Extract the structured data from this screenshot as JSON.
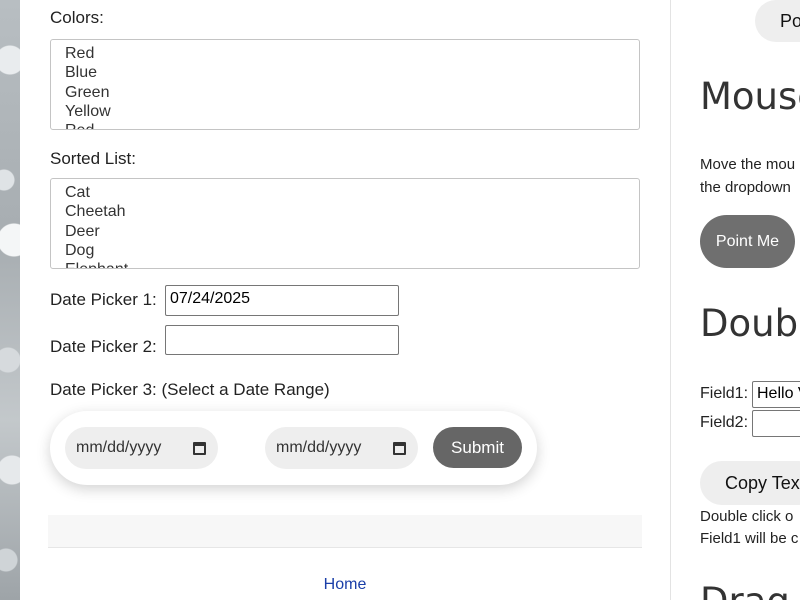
{
  "main": {
    "colors_label": "Colors:",
    "colors_options": [
      "Red",
      "Blue",
      "Green",
      "Yellow",
      "Red"
    ],
    "sorted_label": "Sorted List:",
    "sorted_options": [
      "Cat",
      "Cheetah",
      "Deer",
      "Dog",
      "Elephant"
    ],
    "date_picker_1_label": "Date Picker 1:",
    "date_picker_1_value": "07/24/2025",
    "date_picker_2_label": "Date Picker 2:",
    "date_picker_2_value": "",
    "date_picker_3_label": "Date Picker 3: (Select a Date Range)",
    "range_start_placeholder": "mm/dd/yyyy",
    "range_end_placeholder": "mm/dd/yyyy",
    "submit_label": "Submit",
    "home_link": "Home"
  },
  "right": {
    "top_button_label": "Po",
    "mouse_heading": "Mouse",
    "mouse_text_line1": "Move the mou",
    "mouse_text_line2": "the dropdown",
    "point_me_label": "Point Me",
    "double_heading": "Double",
    "field1_label": "Field1:",
    "field1_value": "Hello V",
    "field2_label": "Field2:",
    "field2_value": "",
    "copy_button_label": "Copy Tex",
    "double_text_line1": "Double click o",
    "double_text_line2": "Field1 will be c",
    "drag_heading": "Drag"
  },
  "icons": {
    "calendar": "calendar-icon"
  }
}
